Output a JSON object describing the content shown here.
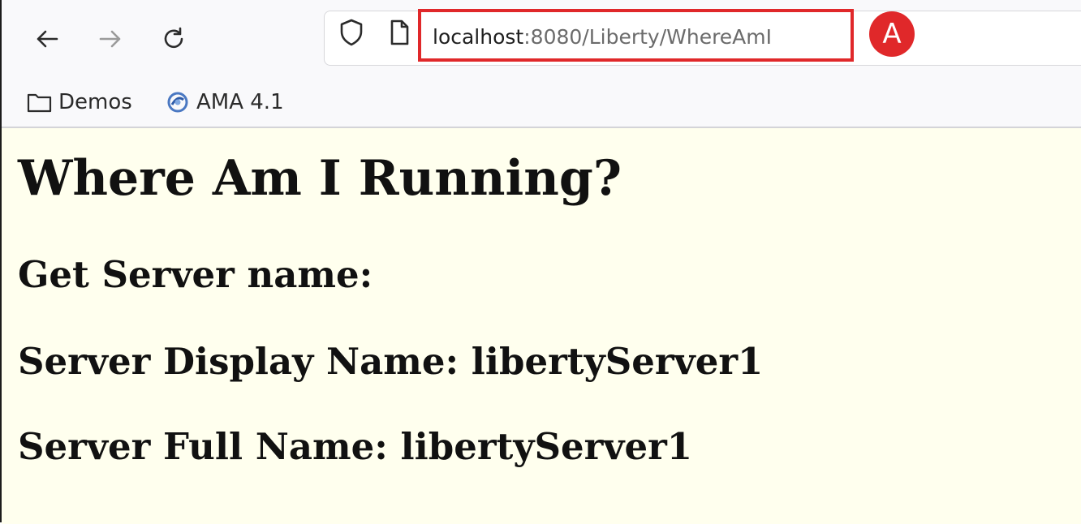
{
  "browser": {
    "url_host": "localhost",
    "url_rest": ":8080/Liberty/WhereAmI",
    "annotation_label": "A",
    "highlight_color": "#e0282a"
  },
  "nav": {
    "icons": [
      "back-arrow-icon",
      "forward-arrow-icon",
      "reload-icon"
    ]
  },
  "bookmarks": [
    {
      "label": "Demos",
      "icon": "folder-icon"
    },
    {
      "label": "AMA 4.1",
      "icon": "ama-logo-icon"
    }
  ],
  "page": {
    "background": "#ffffee",
    "title": "Where Am I Running?",
    "get_server_name": "Get Server name:",
    "server_display_name": "Server Display Name: libertyServer1",
    "server_full_name": "Server Full Name: libertyServer1"
  }
}
